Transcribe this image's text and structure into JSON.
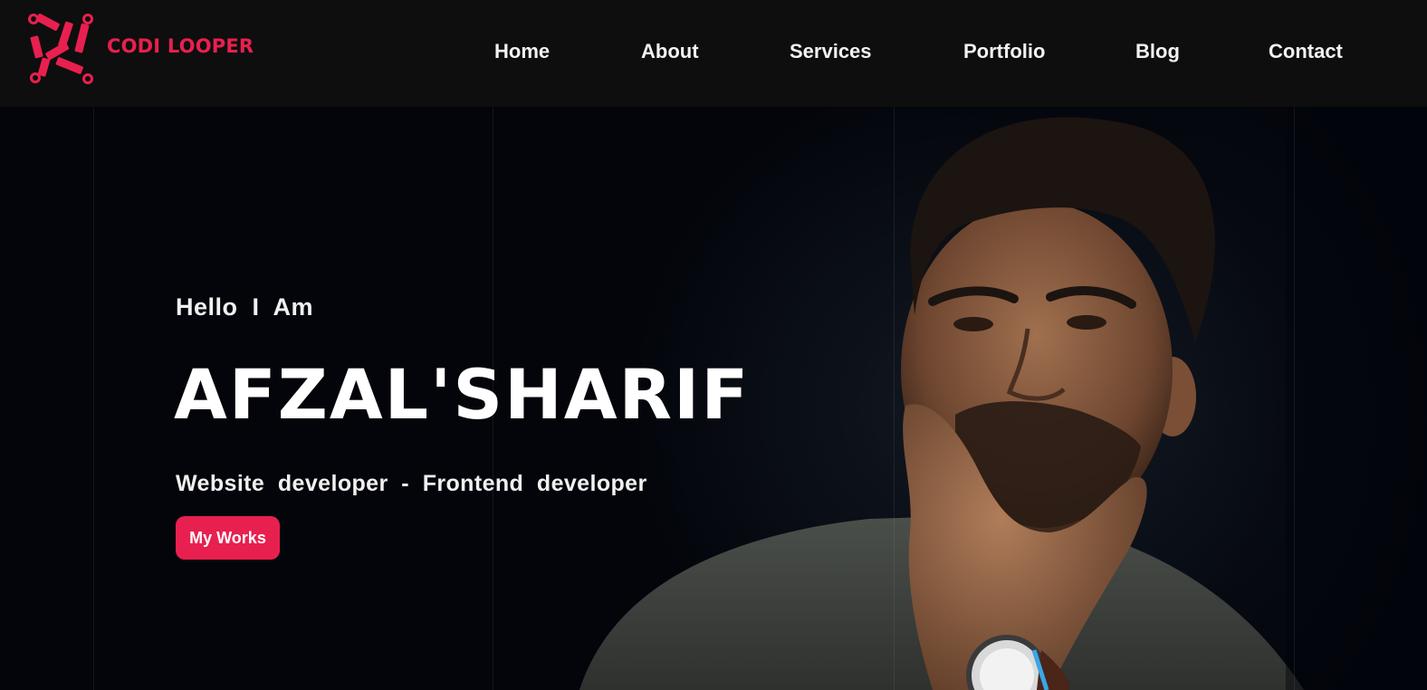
{
  "brand": {
    "name": "CODI LOOPER",
    "logo_icon": "chain-link-logo-icon",
    "accent_color": "#e8204f"
  },
  "nav": {
    "items": [
      {
        "label": "Home"
      },
      {
        "label": "About"
      },
      {
        "label": "Services"
      },
      {
        "label": "Portfolio"
      },
      {
        "label": "Blog"
      },
      {
        "label": "Contact"
      }
    ]
  },
  "hero": {
    "greeting": "Hello  I  Am",
    "name": "AFZAL'SHARIF",
    "subtitle": "Website  developer  -  Frontend  developer",
    "cta_label": "My Works",
    "portrait_icon": "portrait-photo"
  },
  "colors": {
    "navbar_bg": "#0e0e0e",
    "hero_bg": "#03050b",
    "text": "#f0f0f0"
  }
}
